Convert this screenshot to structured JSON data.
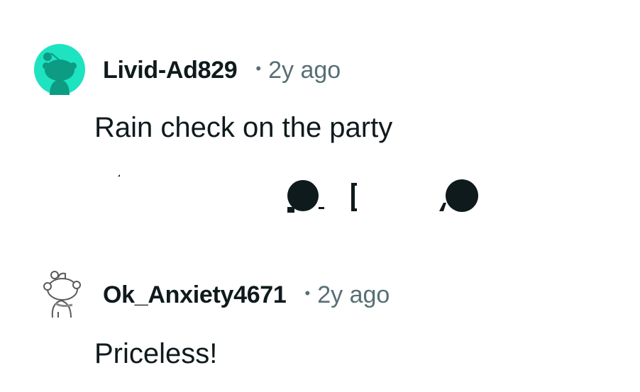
{
  "comments": [
    {
      "username": "Livid-Ad829",
      "separator": "•",
      "timestamp": "2y ago",
      "body": "Rain check on the party",
      "avatar": {
        "icon": "snoo-avatar-icon",
        "background": "#1ee3c0",
        "figure": "#0d9b83"
      }
    },
    {
      "username": "Ok_Anxiety4671",
      "separator": "•",
      "timestamp": "2y ago",
      "body": "Priceless!",
      "avatar": {
        "icon": "snoo-outline-avatar-icon",
        "background": "#ffffff",
        "figure": "#8a8a8a"
      }
    }
  ],
  "colors": {
    "text_primary": "#0f1a1c",
    "text_meta": "#576f76",
    "action_icons": "#0f1a1c"
  }
}
